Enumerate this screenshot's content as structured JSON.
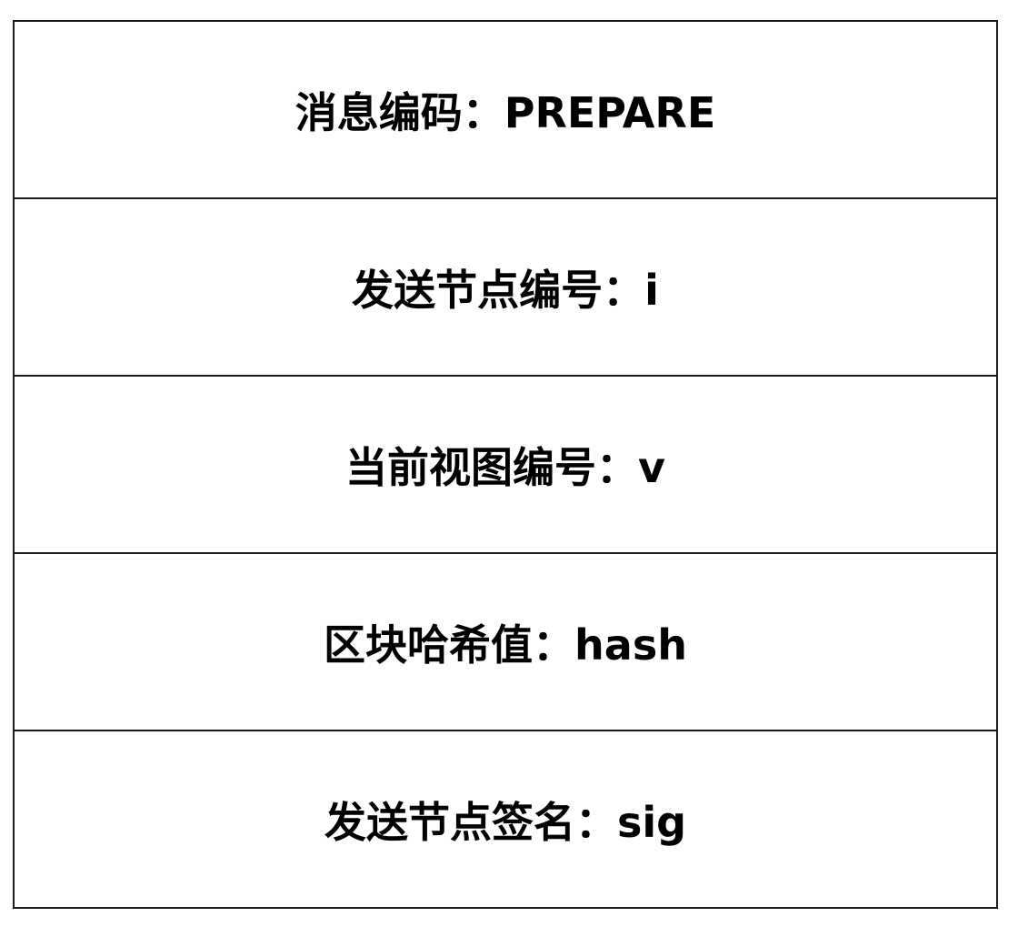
{
  "message_fields": [
    {
      "label": "消息编码：PREPARE"
    },
    {
      "label": "发送节点编号：i"
    },
    {
      "label": "当前视图编号：v"
    },
    {
      "label": "区块哈希值：hash"
    },
    {
      "label": "发送节点签名：sig"
    }
  ]
}
